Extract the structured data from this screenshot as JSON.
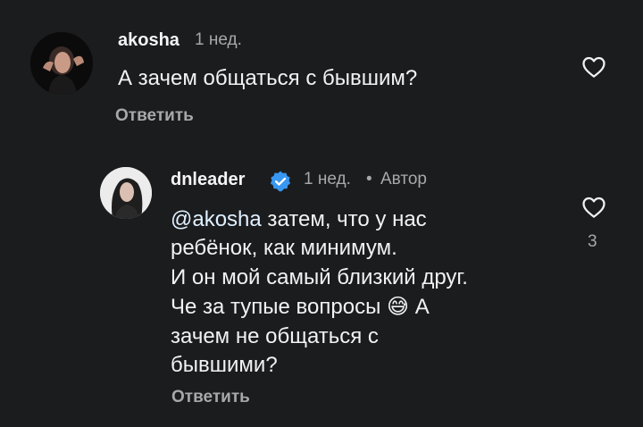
{
  "comments": [
    {
      "username": "akosha",
      "time": "1 нед.",
      "text": "А зачем общаться с бывшим?",
      "reply_label": "Ответить"
    },
    {
      "username": "dnleader",
      "time": "1 нед.",
      "separator": "•",
      "author_badge": "Автор",
      "mention": "@akosha",
      "lines": [
        " затем, что у нас",
        "ребёнок, как минимум.",
        "И он мой самый близкий друг.",
        "Че за тупые вопросы ",
        " А",
        "зачем не общаться с",
        "бывшими?"
      ],
      "emoji": "😅",
      "reply_label": "Ответить",
      "like_count": "3"
    }
  ],
  "colors": {
    "background": "#1b1c1e",
    "verified_badge": "#3897f0",
    "secondary_text": "#a8a8a8"
  },
  "icons": [
    "heart-icon",
    "verified-badge-icon"
  ]
}
